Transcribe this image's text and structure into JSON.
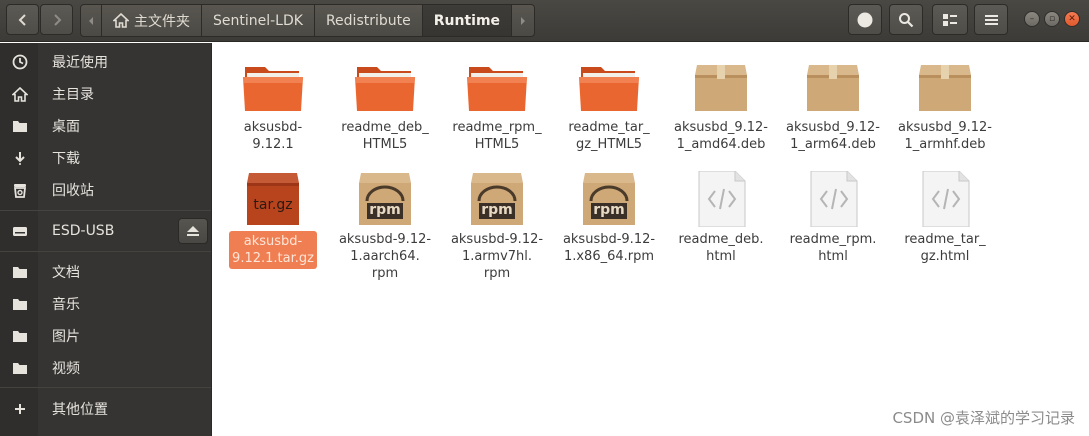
{
  "header": {
    "breadcrumbs": [
      "主文件夹",
      "Sentinel-LDK",
      "Redistribute",
      "Runtime"
    ],
    "active_crumb": "Runtime",
    "buttons": [
      "back",
      "forward",
      "view-toggle",
      "search",
      "view-options",
      "menu"
    ]
  },
  "sidebar": {
    "items": [
      {
        "label": "最近使用",
        "icon": "clock-icon"
      },
      {
        "label": "主目录",
        "icon": "home-icon"
      },
      {
        "label": "桌面",
        "icon": "folder-icon"
      },
      {
        "label": "下载",
        "icon": "download-icon"
      },
      {
        "label": "回收站",
        "icon": "trash-icon"
      },
      {
        "label": "ESD-USB",
        "icon": "drive-icon"
      },
      {
        "label": "文档",
        "icon": "folder-icon"
      },
      {
        "label": "音乐",
        "icon": "folder-icon"
      },
      {
        "label": "图片",
        "icon": "folder-icon"
      },
      {
        "label": "视频",
        "icon": "folder-icon"
      },
      {
        "label": "其他位置",
        "icon": "plus-icon"
      }
    ]
  },
  "files": [
    {
      "name": "aksusbd-\n9.12.1",
      "type": "folder"
    },
    {
      "name": "readme_deb_\nHTML5",
      "type": "folder"
    },
    {
      "name": "readme_rpm_\nHTML5",
      "type": "folder"
    },
    {
      "name": "readme_tar_\ngz_HTML5",
      "type": "folder"
    },
    {
      "name": "aksusbd_9.12-\n1_amd64.deb",
      "type": "package"
    },
    {
      "name": "aksusbd_9.12-\n1_arm64.deb",
      "type": "package"
    },
    {
      "name": "aksusbd_9.12-\n1_armhf.deb",
      "type": "package"
    },
    {
      "name": "aksusbd-\n9.12.1.tar.gz",
      "type": "targz",
      "badge": "tar.gz",
      "selected": true
    },
    {
      "name": "aksusbd-9.12-\n1.aarch64.\nrpm",
      "type": "rpm",
      "badge": "rpm"
    },
    {
      "name": "aksusbd-9.12-\n1.armv7hl.\nrpm",
      "type": "rpm",
      "badge": "rpm"
    },
    {
      "name": "aksusbd-9.12-\n1.x86_64.rpm",
      "type": "rpm",
      "badge": "rpm"
    },
    {
      "name": "readme_deb.\nhtml",
      "type": "html"
    },
    {
      "name": "readme_rpm.\nhtml",
      "type": "html"
    },
    {
      "name": "readme_tar_\ngz.html",
      "type": "html"
    }
  ],
  "watermark": "CSDN @袁泽斌的学习记录",
  "colors": {
    "accent": "#ef7e52",
    "folder": "#e9632c",
    "package": "#cfa878",
    "header": "#3d3b37",
    "sidebar": "#353432"
  }
}
